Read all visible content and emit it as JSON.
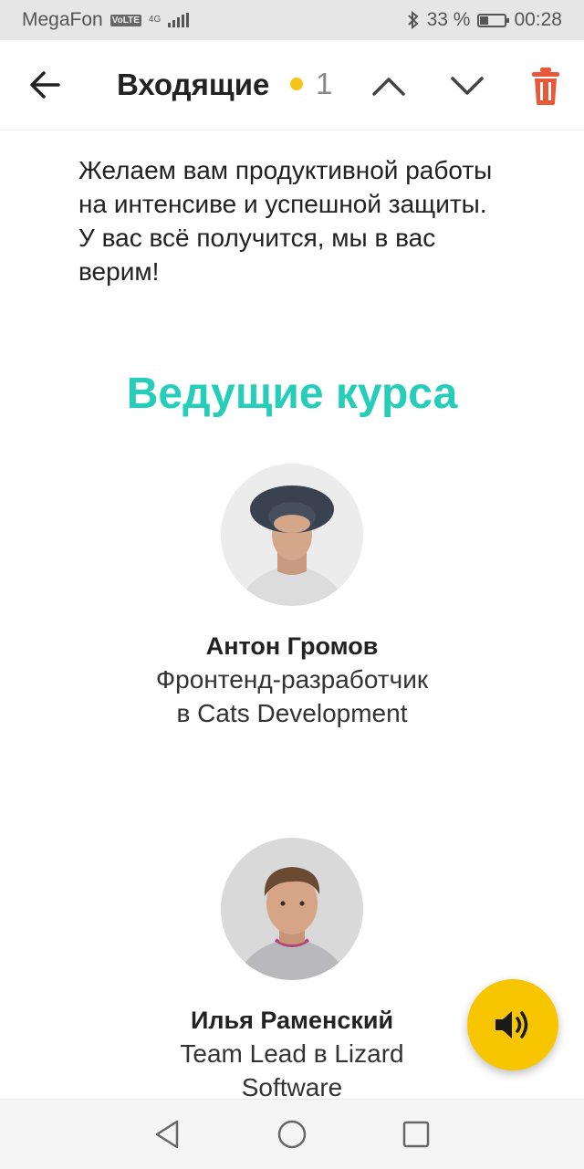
{
  "status_bar": {
    "carrier": "MegaFon",
    "volte": "VoLTE",
    "network": "4G",
    "battery_percent": "33 %",
    "battery_level": 0.33,
    "time": "00:28"
  },
  "toolbar": {
    "title": "Входящие",
    "unread_count": "1",
    "unread_dot_color": "#f5c518",
    "delete_color": "#e8593b"
  },
  "content": {
    "intro_text": "Желаем вам продуктивной работы на интенсиве и успешной защиты. У вас всё получится, мы в вас верим!",
    "section_title": "Ведущие курса",
    "accent_color": "#26cdb9",
    "speakers": [
      {
        "name": "Антон Громов",
        "role": "Фронтенд-разработчик в Cats Development",
        "avatar": "speaker-photo-hat"
      },
      {
        "name": "Илья Раменский",
        "role": "Team Lead в Lizard Software",
        "avatar": "speaker-photo-portrait"
      }
    ]
  },
  "fab": {
    "icon": "speaker-volume-icon",
    "color": "#f7c600"
  },
  "nav_bar": {
    "icons": [
      "nav-back-icon",
      "nav-home-icon",
      "nav-recent-icon"
    ]
  }
}
